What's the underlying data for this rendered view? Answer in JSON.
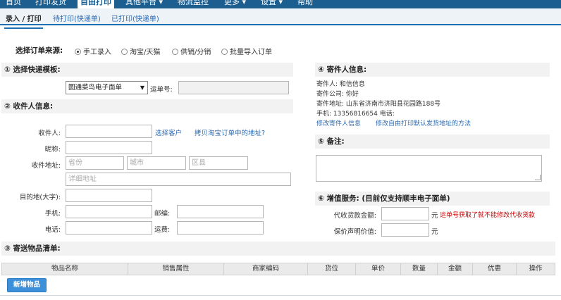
{
  "nav": {
    "items": [
      "首页",
      "打印发货",
      "自由打印",
      "其他平台 ▾",
      "物流监控",
      "更多 ▾",
      "设置 ▾",
      "帮助"
    ],
    "active_index": 2
  },
  "subtabs": {
    "items": [
      "录入 / 打印",
      "待打印(快递单)",
      "已打印(快递单)"
    ],
    "active_index": 0
  },
  "order_source": {
    "label": "选择订单来源:",
    "options": [
      "手工录入",
      "淘宝/天猫",
      "供销/分销",
      "批量导入订单"
    ],
    "selected_index": 0
  },
  "template_section": {
    "title": "① 选择快递模板:",
    "select_value": "圆通菜鸟电子面单",
    "waybill_label": "运单号:",
    "waybill_value": ""
  },
  "receiver_section": {
    "title": "② 收件人信息:",
    "name_label": "收件人:",
    "name_value": "",
    "choose_customer_link": "选择客户",
    "copy_address_link": "拷贝淘宝订单中的地址?",
    "nickname_label": "昵称:",
    "nickname_value": "",
    "address_label": "收件地址:",
    "province_placeholder": "省份",
    "city_placeholder": "城市",
    "district_placeholder": "区县",
    "detail_placeholder": "详细地址",
    "destination_label": "目的地(大字):",
    "destination_value": "",
    "mobile_label": "手机:",
    "mobile_value": "",
    "postcode_label": "邮编:",
    "postcode_value": "",
    "phone_label": "电话:",
    "phone_value": "",
    "freight_label": "运费:",
    "freight_value": ""
  },
  "sender_section": {
    "title": "④ 寄件人信息:",
    "sender_line": "寄件人: 和信信息",
    "company_line": "寄件公司: 你好",
    "address_line": "寄件地址: 山东省济南市济阳县花园路188号",
    "contact_line": "手机: 13356816654 电话:",
    "edit_sender_link": "修改寄件人信息",
    "edit_default_link": "修改自由打印默认发货地址的方法"
  },
  "remark_section": {
    "title": "⑤ 备注:",
    "remark_value": ""
  },
  "value_added_section": {
    "title": "⑥ 增值服务: (目前仅支持顺丰电子面单)",
    "cod_label": "代收货款金额:",
    "cod_value": "",
    "cod_unit": "元",
    "cod_warning": "运单号获取了就不能修改代收货款",
    "insured_label": "保价声明价值:",
    "insured_value": "",
    "insured_unit": "元"
  },
  "goods_section": {
    "title": "③ 寄送物品清单:",
    "columns": [
      "物品名称",
      "销售属性",
      "商家编码",
      "货位",
      "单价",
      "数量",
      "金额",
      "优惠",
      "操作"
    ],
    "add_button": "新增物品"
  }
}
